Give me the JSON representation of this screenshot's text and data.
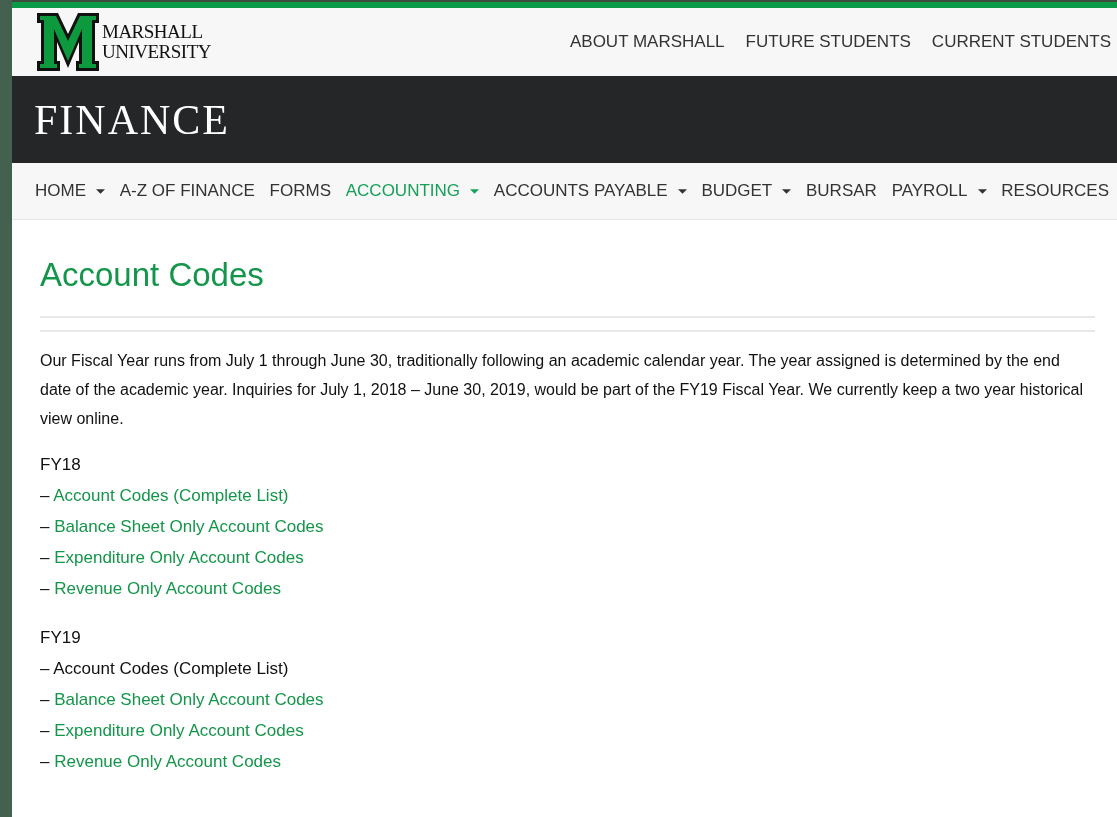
{
  "header": {
    "logo_lines": [
      "MARSHALL",
      "UNIVERSITY"
    ],
    "top_links": [
      "ABOUT MARSHALL",
      "FUTURE STUDENTS",
      "CURRENT STUDENTS"
    ]
  },
  "banner": {
    "title": "FINANCE"
  },
  "nav": [
    {
      "label": "HOME",
      "dropdown": true,
      "selected": false
    },
    {
      "label": "A-Z OF FINANCE",
      "dropdown": false,
      "selected": false
    },
    {
      "label": "FORMS",
      "dropdown": false,
      "selected": false
    },
    {
      "label": "ACCOUNTING",
      "dropdown": true,
      "selected": true
    },
    {
      "label": "ACCOUNTS PAYABLE",
      "dropdown": true,
      "selected": false
    },
    {
      "label": "BUDGET",
      "dropdown": true,
      "selected": false
    },
    {
      "label": "BURSAR",
      "dropdown": false,
      "selected": false
    },
    {
      "label": "PAYROLL",
      "dropdown": true,
      "selected": false
    },
    {
      "label": "RESOURCES",
      "dropdown": false,
      "selected": false
    }
  ],
  "page": {
    "heading": "Account Codes",
    "intro": "Our Fiscal Year runs from July 1 through June 30, traditionally following an academic calendar year. The year assigned is determined by the end date of the academic year. Inquiries for July 1, 2018 – June 30, 2019, would be part of the FY19 Fiscal Year. We currently keep a two year historical view online.",
    "sections": [
      {
        "title": "FY18",
        "items": [
          {
            "dash": "–",
            "text": "Account Codes (Complete List)",
            "linked": true
          },
          {
            "dash": "–",
            "text": "Balance Sheet Only Account Codes",
            "linked": true
          },
          {
            "dash": "–",
            "text": "Expenditure Only Account Codes",
            "linked": true
          },
          {
            "dash": "–",
            "text": "Revenue Only Account Codes",
            "linked": true
          }
        ]
      },
      {
        "title": "FY19",
        "items": [
          {
            "dash": "–",
            "text": "Account Codes (Complete List)",
            "linked": false
          },
          {
            "dash": "–",
            "text": "Balance Sheet Only Account Codes",
            "linked": true
          },
          {
            "dash": "–",
            "text": "Expenditure Only Account Codes",
            "linked": true
          },
          {
            "dash": "–",
            "text": "Revenue Only Account Codes",
            "linked": true
          }
        ]
      }
    ]
  }
}
